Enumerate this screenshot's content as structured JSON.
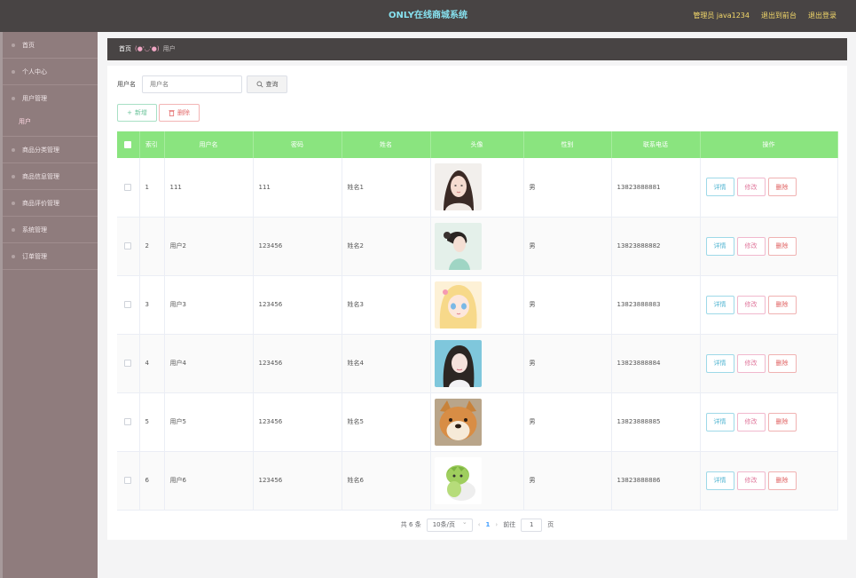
{
  "header": {
    "title": "ONLY在线商城系统",
    "admin": "管理员 java1234",
    "exit_to_front": "退出到前台",
    "logout": "退出登录"
  },
  "sidebar": {
    "items": [
      {
        "label": "首页"
      },
      {
        "label": "个人中心"
      },
      {
        "label": "用户管理"
      },
      {
        "label": "用户",
        "sub": true
      },
      {
        "label": "商品分类管理"
      },
      {
        "label": "商品信息管理"
      },
      {
        "label": "商品评价管理"
      },
      {
        "label": "系统管理"
      },
      {
        "label": "订单管理"
      }
    ]
  },
  "breadcrumb": {
    "home": "首页",
    "face": "(●'◡'●)",
    "current": "用户"
  },
  "search": {
    "label": "用户名",
    "placeholder": "用户名",
    "query_button": "查询"
  },
  "actions": {
    "add": "新增",
    "delete": "删除"
  },
  "table": {
    "columns": [
      "索引",
      "用户名",
      "密码",
      "姓名",
      "头像",
      "性别",
      "联系电话",
      "操作"
    ],
    "rows": [
      {
        "index": "1",
        "username": "111",
        "password": "111",
        "name": "姓名1",
        "gender": "男",
        "phone": "13823888881"
      },
      {
        "index": "2",
        "username": "用户2",
        "password": "123456",
        "name": "姓名2",
        "gender": "男",
        "phone": "13823888882"
      },
      {
        "index": "3",
        "username": "用户3",
        "password": "123456",
        "name": "姓名3",
        "gender": "男",
        "phone": "13823888883"
      },
      {
        "index": "4",
        "username": "用户4",
        "password": "123456",
        "name": "姓名4",
        "gender": "男",
        "phone": "13823888884"
      },
      {
        "index": "5",
        "username": "用户5",
        "password": "123456",
        "name": "姓名5",
        "gender": "男",
        "phone": "13823888885"
      },
      {
        "index": "6",
        "username": "用户6",
        "password": "123456",
        "name": "姓名6",
        "gender": "男",
        "phone": "13823888886"
      }
    ],
    "row_actions": {
      "detail": "详情",
      "edit": "修改",
      "remove": "删除"
    }
  },
  "pagination": {
    "total": "共 6 条",
    "page_size": "10条/页",
    "current_page": "1",
    "goto_label": "前往",
    "goto_value": "1",
    "page_unit": "页"
  },
  "colors": {
    "topbar": "#484444",
    "sidebar": "#8f7c7d",
    "table_header": "#8ae47f",
    "title": "#87e2f0",
    "header_links": "#f3d86a"
  }
}
